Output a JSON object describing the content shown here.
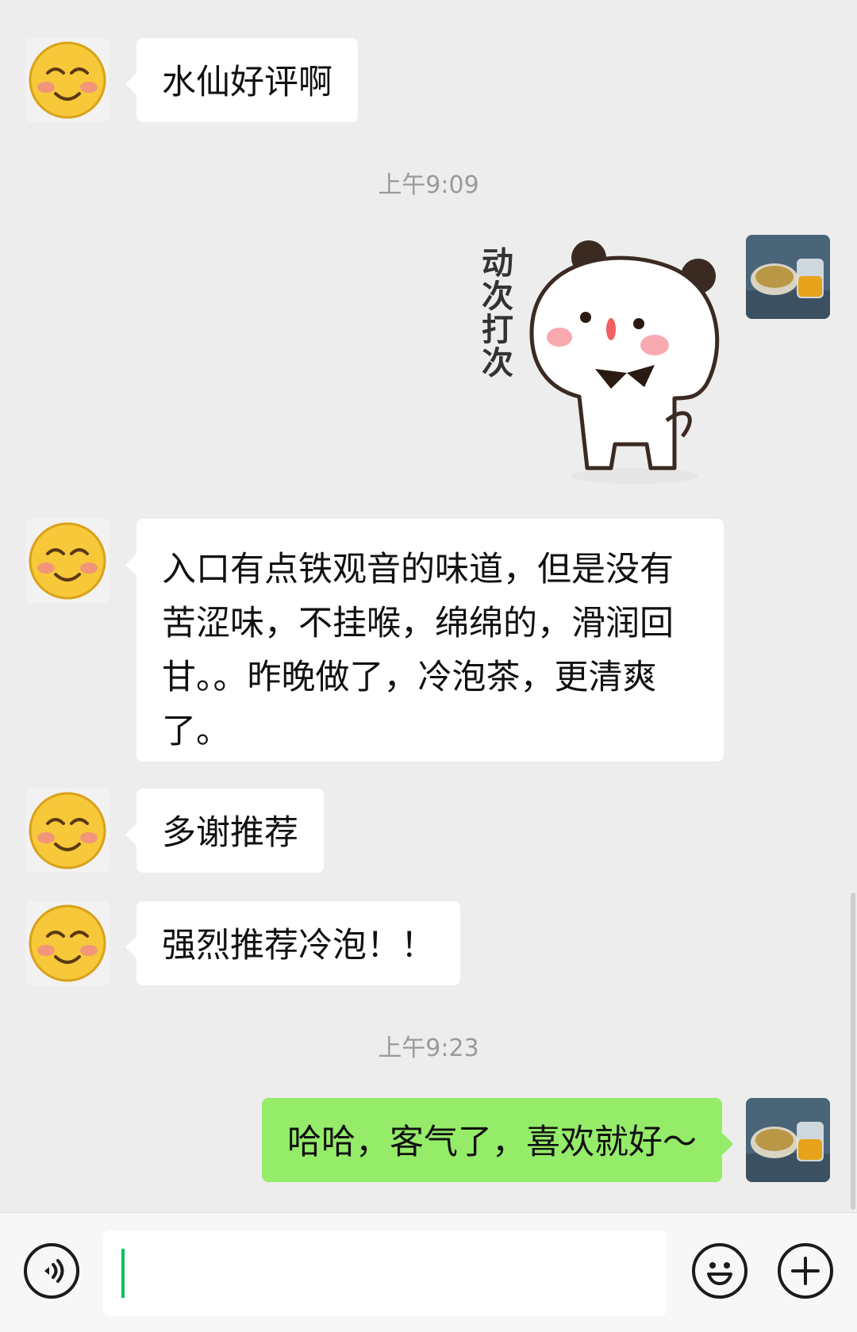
{
  "messages": [
    {
      "side": "left",
      "text": "水仙好评啊"
    },
    {
      "type": "time",
      "text": "上午9:09"
    },
    {
      "side": "right",
      "type": "sticker",
      "sticker_text": "动次打次"
    },
    {
      "side": "left",
      "lines": [
        "入口有点铁观音的味道，但是没有",
        "苦涩味，不挂喉，绵绵的，滑润回",
        "甘。。昨晚做了，冷泡茶，更清爽",
        "了。"
      ]
    },
    {
      "side": "left",
      "text": "多谢推荐"
    },
    {
      "side": "left",
      "text": "强烈推荐冷泡！！"
    },
    {
      "type": "time",
      "text": "上午9:23"
    },
    {
      "side": "right",
      "text": "哈哈，客气了，喜欢就好～"
    }
  ],
  "input": {
    "value": "",
    "placeholder": ""
  },
  "icons": {
    "voice": "voice-icon",
    "emoji": "emoji-icon",
    "more": "plus-icon",
    "left_avatar": "smiley-avatar",
    "right_avatar": "tea-photo-avatar"
  },
  "colors": {
    "outgoing_bubble": "#95ec69",
    "incoming_bubble": "#ffffff",
    "background": "#ededed",
    "caret": "#07c160"
  }
}
